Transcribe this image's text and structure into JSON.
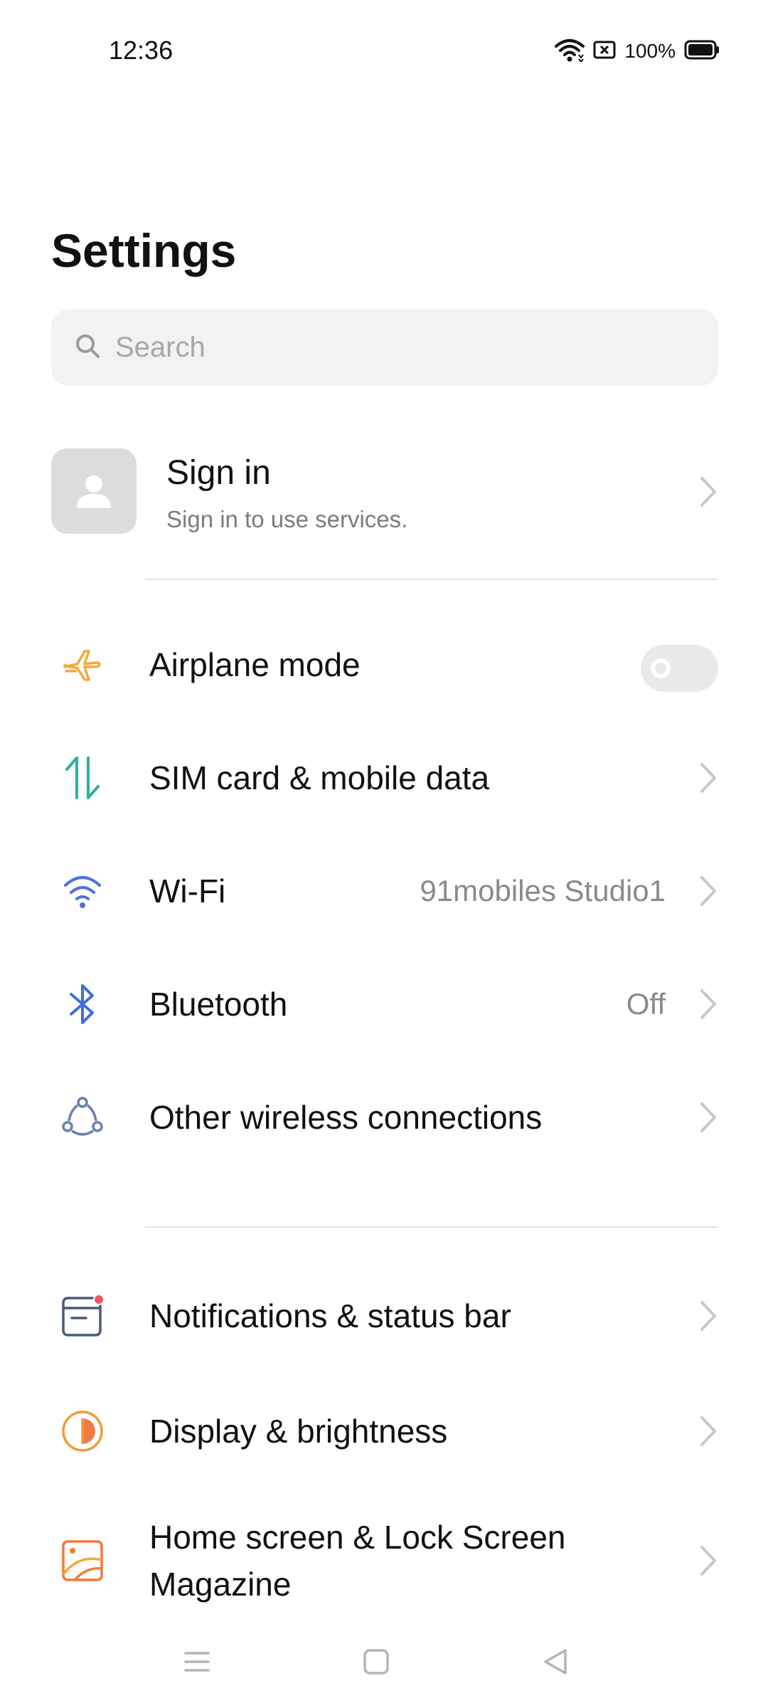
{
  "status_bar": {
    "time": "12:36",
    "battery_percent": "100%",
    "icons": [
      "wifi-icon",
      "screen-record-icon",
      "battery-icon"
    ]
  },
  "page": {
    "title": "Settings"
  },
  "search": {
    "placeholder": "Search",
    "value": ""
  },
  "account": {
    "title": "Sign in",
    "subtitle": "Sign in to use services."
  },
  "connectivity": {
    "airplane": {
      "label": "Airplane mode",
      "icon": "airplane-icon",
      "enabled": false
    },
    "sim": {
      "label": "SIM card & mobile data",
      "icon": "mobile-data-icon"
    },
    "wifi": {
      "label": "Wi-Fi",
      "value": "91mobiles Studio1",
      "icon": "wifi-icon"
    },
    "bluetooth": {
      "label": "Bluetooth",
      "value": "Off",
      "icon": "bluetooth-icon"
    },
    "other": {
      "label": "Other wireless connections",
      "icon": "wireless-connections-icon"
    }
  },
  "system": {
    "notifications": {
      "label": "Notifications & status bar",
      "icon": "notification-icon"
    },
    "display": {
      "label": "Display & brightness",
      "icon": "brightness-icon"
    },
    "home": {
      "label": "Home screen & Lock Screen Magazine",
      "icon": "wallpaper-icon"
    }
  },
  "colors": {
    "airplane": "#f2a93b",
    "sim": "#2bb39a",
    "wifi": "#4f6fe0",
    "bluetooth": "#3e6fd8",
    "other": "#6b7fb0",
    "notifications": "#4a5a7a",
    "notification_dot": "#f05a5a",
    "display": "#f29a3a",
    "home": "#f07a3a"
  },
  "nav": {
    "icons": [
      "menu-icon",
      "home-icon",
      "back-icon"
    ]
  }
}
